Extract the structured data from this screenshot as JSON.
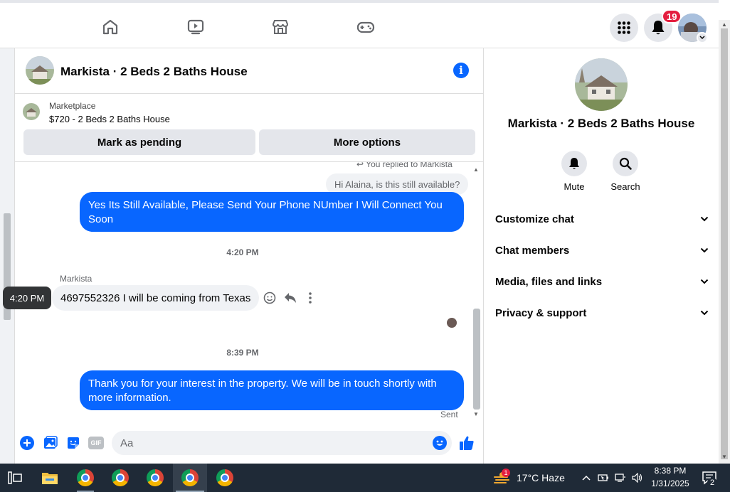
{
  "topnav": {
    "notification_count": "19"
  },
  "chat": {
    "title": "Markista · 2 Beds 2 Baths House",
    "marketplace_label": "Marketplace",
    "listing": "$720 - 2 Beds 2 Baths House",
    "mark_pending": "Mark as pending",
    "more_options": "More options",
    "replied_note": "You replied to Markista",
    "quoted_message": "Hi Alaina, is this still available?",
    "msg1": "Yes Its Still Available, Please Send Your Phone NUmber I Will Connect You Soon",
    "time1": "4:20 PM",
    "sender": "Markista",
    "msg2": "4697552326 I will be coming from Texas",
    "tooltip_time": "4:20 PM",
    "time2": "8:39 PM",
    "msg3": "Thank you for your interest in the property. We will be in touch shortly with more information.",
    "status": "Sent",
    "composer_placeholder": "Aa",
    "gif_label": "GIF"
  },
  "right": {
    "title": "Markista · 2 Beds 2 Baths House",
    "mute": "Mute",
    "search": "Search",
    "rows": [
      "Customize chat",
      "Chat members",
      "Media, files and links",
      "Privacy & support"
    ]
  },
  "taskbar": {
    "weather_badge": "1",
    "weather": "17°C  Haze",
    "time": "8:38 PM",
    "date": "1/31/2025",
    "notif_count": "2"
  },
  "colors": {
    "accent": "#0866ff",
    "badge": "#e41e3f"
  }
}
